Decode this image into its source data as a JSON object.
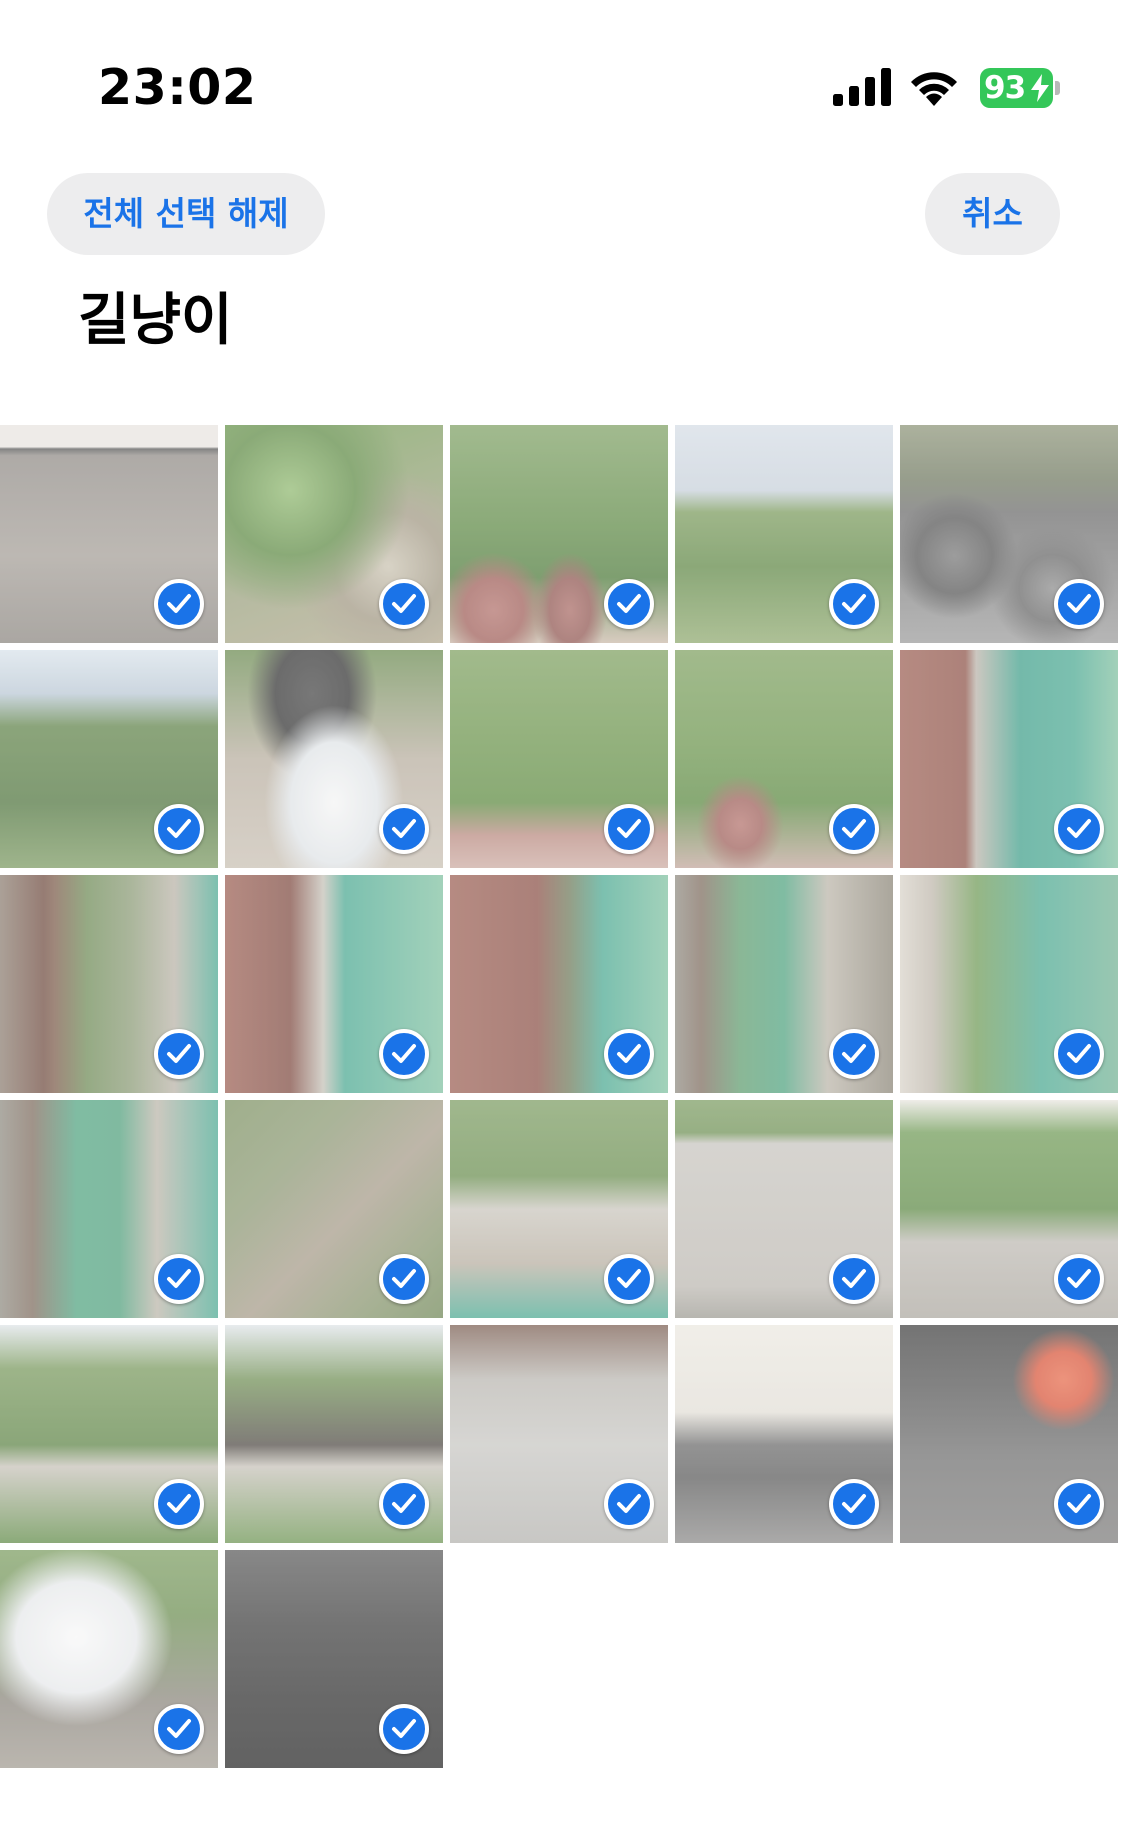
{
  "status_bar": {
    "time": "23:02",
    "battery": "93",
    "icons": [
      "cellular-signal-icon",
      "wifi-icon",
      "battery-charging-icon"
    ]
  },
  "nav": {
    "deselect_all_label": "전체 선택 해제",
    "cancel_label": "취소"
  },
  "album": {
    "title": "길냥이"
  },
  "colors": {
    "accent": "#1a73e8",
    "pill_bg": "#ededee",
    "battery_green": "#34c759"
  },
  "photos": [
    {
      "thumb": "t-stairs",
      "selected": true
    },
    {
      "thumb": "t-ivy",
      "selected": true
    },
    {
      "thumb": "t-pots",
      "selected": true
    },
    {
      "thumb": "t-hills",
      "selected": true
    },
    {
      "thumb": "t-rocks",
      "selected": true
    },
    {
      "thumb": "t-trees",
      "selected": true
    },
    {
      "thumb": "t-bowl",
      "selected": true
    },
    {
      "thumb": "t-bushes",
      "selected": true
    },
    {
      "thumb": "t-bushes2",
      "selected": true
    },
    {
      "thumb": "t-fence",
      "selected": true
    },
    {
      "thumb": "t-gutter",
      "selected": true
    },
    {
      "thumb": "t-alley",
      "selected": true
    },
    {
      "thumb": "t-alley2",
      "selected": true
    },
    {
      "thumb": "t-catwalk",
      "selected": true
    },
    {
      "thumb": "t-leaves",
      "selected": true
    },
    {
      "thumb": "t-catwalk2",
      "selected": true
    },
    {
      "thumb": "t-blur",
      "selected": true
    },
    {
      "thumb": "t-yard",
      "selected": true
    },
    {
      "thumb": "t-wall",
      "selected": true
    },
    {
      "thumb": "t-catwall",
      "selected": true
    },
    {
      "thumb": "t-garden",
      "selected": true
    },
    {
      "thumb": "t-garden2",
      "selected": true
    },
    {
      "thumb": "t-street",
      "selected": true
    },
    {
      "thumb": "t-car",
      "selected": true
    },
    {
      "thumb": "t-road",
      "selected": true
    },
    {
      "thumb": "t-basin",
      "selected": true
    },
    {
      "thumb": "t-dark",
      "selected": true
    }
  ]
}
